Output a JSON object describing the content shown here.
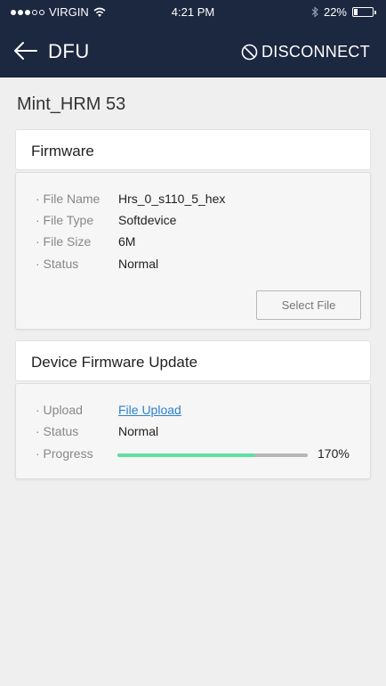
{
  "status_bar": {
    "carrier": "VIRGIN",
    "time": "4:21 PM",
    "battery": "22%",
    "battery_level": 0.22,
    "signal_bars": 3,
    "signal_total": 5,
    "icons": [
      "wifi-icon",
      "bluetooth-icon",
      "battery-icon"
    ]
  },
  "nav": {
    "title": "DFU",
    "back_icon": "arrow-left-icon",
    "disconnect_label": "DISCONNECT",
    "disconnect_icon": "prohibited-icon"
  },
  "device_name": "Mint_HRM 53",
  "firmware": {
    "title": "Firmware",
    "rows": [
      {
        "label": "· File Name",
        "value": "Hrs_0_s110_5_hex"
      },
      {
        "label": "· File Type",
        "value": "Softdevice"
      },
      {
        "label": "· File Size",
        "value": "6M"
      },
      {
        "label": "· Status",
        "value": "Normal"
      }
    ],
    "select_button": "Select File"
  },
  "dfu": {
    "title": "Device Firmware Update",
    "upload_label": "· Upload",
    "upload_link": "File Upload",
    "status_label": "· Status",
    "status_value": "Normal",
    "progress_label": "· Progress",
    "progress_text": "170%",
    "progress_fill": 0.72
  },
  "colors": {
    "header_bg": "#1c2740",
    "background": "#efefef",
    "progress": "#5ee0a0",
    "link": "#2b82d0"
  }
}
